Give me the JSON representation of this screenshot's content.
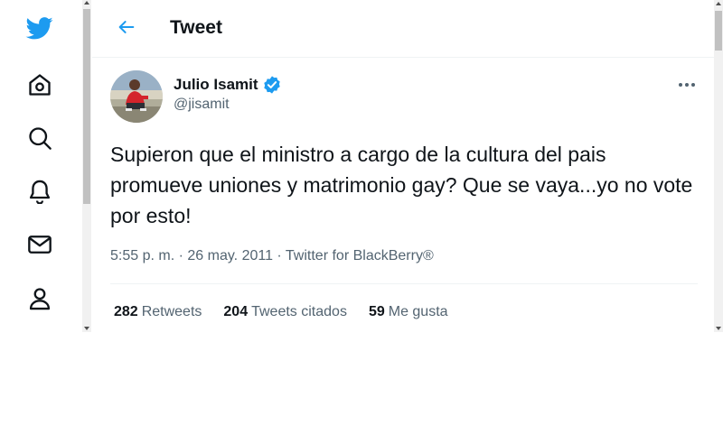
{
  "colors": {
    "brand": "#1d9bf0",
    "text_primary": "#0f1419",
    "text_secondary": "#536471",
    "divider": "#eff3f4"
  },
  "sidebar": {
    "items": [
      {
        "icon": "twitter-logo-icon"
      },
      {
        "icon": "home-icon"
      },
      {
        "icon": "search-icon"
      },
      {
        "icon": "bell-icon"
      },
      {
        "icon": "mail-icon"
      },
      {
        "icon": "profile-icon"
      }
    ]
  },
  "header": {
    "back_icon": "arrow-left-icon",
    "title": "Tweet"
  },
  "tweet": {
    "author": {
      "name": "Julio Isamit",
      "handle": "@jisamit",
      "verified_icon": "verified-badge-icon"
    },
    "more_icon": "more-horizontal-icon",
    "text": "Supieron que el ministro a cargo de la cultura del pais promueve uniones y matrimonio gay? Que se vaya...yo no vote por esto!",
    "meta": {
      "time": "5:55 p. m.",
      "separator": "·",
      "date": "26 may. 2011",
      "source": "Twitter for BlackBerry®"
    },
    "stats": {
      "retweets_count": "282",
      "retweets_label": "Retweets",
      "quotes_count": "204",
      "quotes_label": "Tweets citados",
      "likes_count": "59",
      "likes_label": "Me gusta"
    }
  }
}
